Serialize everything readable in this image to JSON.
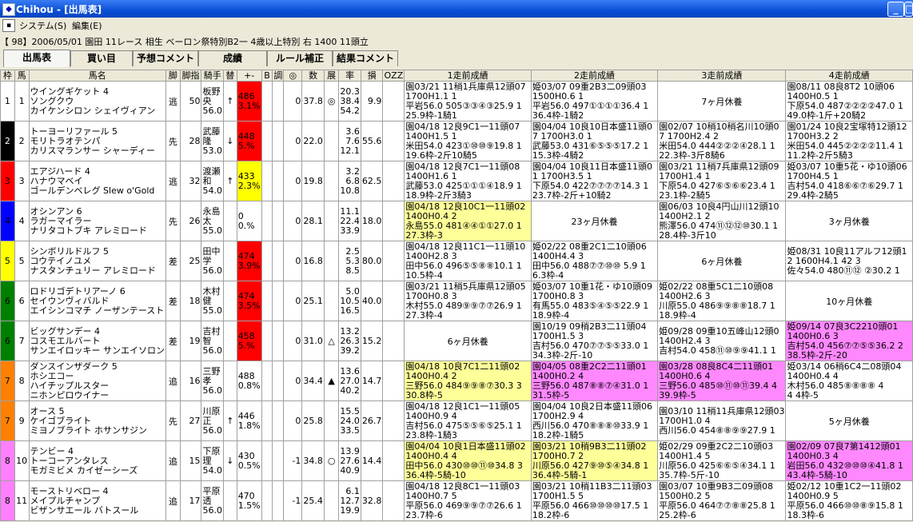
{
  "window": {
    "title": "Chihou - [出馬表]",
    "btn_min": "_",
    "btn_close": "□"
  },
  "menu": {
    "system": "システム(S)",
    "edit": "編集(E)"
  },
  "race_info": "【 98】2006/05/01 園田 11レース 相生 ベーロン祭特別B2一 4歳以上特別 右 1400 11頭立",
  "tabs": [
    "出馬表",
    "買い目",
    "予想コメント",
    "成績",
    "ルール補正",
    "結果コメント"
  ],
  "headers": [
    "枠",
    "馬",
    "馬名",
    "脚",
    "脚指",
    "騎手",
    "替",
    "+-",
    "B",
    "調",
    "◎",
    "数",
    "展",
    "率",
    "損",
    "OZZ",
    "1走前成績",
    "2走前成績",
    "3走前成績",
    "4走前成績"
  ],
  "colors": {
    "waku1": "#ffffff",
    "waku2": "#000000",
    "waku3": "#ff0000",
    "waku4": "#0000ff",
    "waku5": "#ffff00",
    "waku6": "#008000",
    "waku7": "#ff8000",
    "waku8": "#ff80ff",
    "highlight_yellow": "#ffff99",
    "highlight_pink": "#ff88ff"
  },
  "rows": [
    {
      "waku": "1",
      "ban": "1",
      "wcolor": "#ffffff",
      "wtext": "#000",
      "name": [
        "ウイングギケット 4",
        "ソングクウ",
        "カイケンシロン シェイヴィアン"
      ],
      "kyaku": "逃",
      "shi": "50",
      "jockey": [
        "板野",
        "央",
        "56.0"
      ],
      "ka": "↑",
      "diff": [
        "486",
        "3.1%"
      ],
      "diffbg": "red",
      "b": "",
      "cho": "0",
      "shirushi": "37.8",
      "kazu": "◎",
      "ten": "",
      "odds": [
        "20.3",
        "38.4",
        "54.2"
      ],
      "son": "9.9",
      "r1": {
        "lines": [
          "園03/21 11稍1兵庫県12頭07",
          "1700H1.1 1",
          "平岩56.0 505③③④③25.9 1",
          "25.9枠-1騎1"
        ],
        "bg": ""
      },
      "r2": {
        "lines": [
          "姫03/07 09重2B3二09頭03",
          "1500H0.6 1",
          "平岩56.0 497①①①①36.4 1",
          "36.4枠-1騎2"
        ],
        "bg": ""
      },
      "r3": {
        "rest": "7ヶ月休養",
        "bg": ""
      },
      "r4": {
        "lines": [
          "園08/11 08良8T2 10頭06",
          "1400H0.5 1",
          "下原54.0 487②②②②47.0 1",
          "49.0枠-1斤+20騎2"
        ],
        "bg": ""
      }
    },
    {
      "waku": "2",
      "ban": "2",
      "wcolor": "#000000",
      "wtext": "#fff",
      "name": [
        "トーヨーリファール 5",
        "モリトラオテンパ",
        "カリスマランサー シャーディー"
      ],
      "kyaku": "先",
      "shi": "28",
      "jockey": [
        "武藤",
        "隆",
        "53.0"
      ],
      "ka": "↓",
      "diff": [
        "448",
        "5.%"
      ],
      "diffbg": "red",
      "b": "",
      "cho": "0",
      "shirushi": "22.0",
      "kazu": "",
      "ten": "",
      "odds": [
        "3.6",
        "7.6",
        "12.1"
      ],
      "son": "55.6",
      "r1": {
        "lines": [
          "園04/18 12良9C1一11頭07",
          "1400H1.5 1",
          "米田54.0 423①⑩⑩⑨19.8 1",
          "19.6枠-2斤10騎5"
        ],
        "bg": ""
      },
      "r2": {
        "lines": [
          "園04/04 10良10日本盛11頭0",
          "7 1700H3.0 1",
          "武藤53.0 431⑥⑤⑤⑤17.2 1",
          "15.3枠-4騎2"
        ],
        "bg": ""
      },
      "r3": {
        "lines": [
          "園02/07 10稍10稍名川10頭0",
          "7 1700H2.4 2",
          "米田54.0 444②②②④28.1 1",
          "22.3枠-3斤8騎6"
        ],
        "bg": ""
      },
      "r4": {
        "lines": [
          "園01/24 10良2宝塚特12頭12",
          "1700H3.2 2",
          "米田54.0 445②②②②11.4 1",
          "11.2枠-2斤5騎3"
        ],
        "bg": ""
      }
    },
    {
      "waku": "3",
      "ban": "3",
      "wcolor": "#ff0000",
      "wtext": "#000",
      "name": [
        "エアジハード 4",
        "ハナウマベイ",
        "ゴールデンベレグ Slew o'Gold"
      ],
      "kyaku": "逃",
      "shi": "32",
      "jockey": [
        "渡瀬",
        "和",
        "54.0"
      ],
      "ka": "↑",
      "diff": [
        "433",
        "2.3%"
      ],
      "diffbg": "ybg",
      "b": "",
      "cho": "0",
      "shirushi": "19.8",
      "kazu": "",
      "ten": "",
      "odds": [
        "3.2",
        "6.8",
        "10.8"
      ],
      "son": "62.5",
      "r1": {
        "lines": [
          "園04/18 12良7C1一11頭08",
          "1400H1.6 1",
          "武藤53.0 425①①①④18.9 1",
          "18.9枠-2斤3騎3"
        ],
        "bg": ""
      },
      "r2": {
        "lines": [
          "園04/04 10良11日本盛11頭0",
          "1 1700H3.5 1",
          "下原54.0 422⑦⑦⑦⑦14.3 1",
          "23.7枠-2斤+10騎2"
        ],
        "bg": ""
      },
      "r3": {
        "lines": [
          "園03/21 11稍7兵庫県12頭09",
          "1700H1.4 1",
          "下原54.0 427⑥⑤⑥⑥23.4 1",
          "23.1枠-2騎5"
        ],
        "bg": ""
      },
      "r4": {
        "lines": [
          "姫03/07 10重5花・ゆ10頭06",
          "1700H4.5 1",
          "吉村54.0 418⑥⑥⑦⑥29.7 1",
          "29.4枠-2騎5"
        ],
        "bg": ""
      }
    },
    {
      "waku": "4",
      "ban": "4",
      "wcolor": "#0000ff",
      "wtext": "#000",
      "name": [
        "オシンアン 6",
        "ラガーマイラー",
        "ナリタコトブキ アレミロード"
      ],
      "kyaku": "先",
      "shi": "26",
      "jockey": [
        "永島",
        "太",
        "55.0"
      ],
      "ka": "",
      "diff": [
        "0",
        "0.%"
      ],
      "diffbg": "",
      "b": "",
      "cho": "0",
      "shirushi": "28.1",
      "kazu": "",
      "ten": "",
      "odds": [
        "11.1",
        "22.4",
        "33.9"
      ],
      "son": "18.0",
      "r1": {
        "lines": [
          "園04/18 12良10C1一11頭02",
          "1400H0.4 2",
          "永島55.0 481④④①①27.0 1",
          "27.3枠-3"
        ],
        "bg": "yellow"
      },
      "r2": {
        "rest": "23ヶ月休養",
        "bg": ""
      },
      "r3": {
        "lines": [
          "園06/03 10良4円山川12頭10",
          "1400H2.1 2",
          "熊澤56.0 474⑪⑫⑫⑩30.1 1",
          "28.4枠-3斤10"
        ],
        "bg": ""
      },
      "r4": {
        "rest": "3ヶ月休養",
        "bg": ""
      }
    },
    {
      "waku": "5",
      "ban": "5",
      "wcolor": "#ffff00",
      "wtext": "#000",
      "name": [
        "シンボリルドルフ 5",
        "コウテイノユメ",
        "ナスタンチュリー アレミロード"
      ],
      "kyaku": "差",
      "shi": "25",
      "jockey": [
        "田中",
        "学",
        "56.0"
      ],
      "ka": "",
      "diff": [
        "474",
        "3.9%"
      ],
      "diffbg": "red",
      "b": "",
      "cho": "0",
      "shirushi": "16.8",
      "kazu": "",
      "ten": "",
      "odds": [
        "2.5",
        "5.3",
        "8.5"
      ],
      "son": "80.0",
      "r1": {
        "lines": [
          "園04/18 12良11C1一11頭10",
          "1400H2.8 3",
          "田中56.0 496⑤⑤⑧⑧10.1 1",
          "10.5枠-4"
        ],
        "bg": ""
      },
      "r2": {
        "lines": [
          "姫02/22 08重2C1二10頭06",
          "1400H4.4 3",
          "田中56.0 488⑦⑦⑩⑩ 5.9 1",
          "6.3枠-4"
        ],
        "bg": ""
      },
      "r3": {
        "rest": "6ヶ月休養",
        "bg": ""
      },
      "r4": {
        "lines": [
          "姫08/31 10良11アルフ12頭1",
          "2 1600H4.1 42 3",
          "佐々54.0 480⑪⑫ ②30.2 1"
        ],
        "bg": ""
      }
    },
    {
      "waku": "6",
      "ban": "6",
      "wcolor": "#008000",
      "wtext": "#000",
      "name": [
        "ロドリゴデトリアーノ 6",
        "セイウンヴィバルド",
        "エイシンコマチ ノーザンテースト"
      ],
      "kyaku": "差",
      "shi": "18",
      "jockey": [
        "木村",
        "健",
        "55.0"
      ],
      "ka": "",
      "diff": [
        "474",
        "3.5%"
      ],
      "diffbg": "red",
      "b": "",
      "cho": "0",
      "shirushi": "25.1",
      "kazu": "",
      "ten": "",
      "odds": [
        "5.0",
        "10.5",
        "16.5"
      ],
      "son": "40.0",
      "r1": {
        "lines": [
          "園03/21 11稍5兵庫県12頭05",
          "1700H0.8 3",
          "木村55.0 489⑨⑨⑦⑦26.9 1",
          "27.3枠-4"
        ],
        "bg": ""
      },
      "r2": {
        "lines": [
          "姫03/07 10重1花・ゆ10頭09",
          "1700H0.8 3",
          "有馬55.0 483⑤④⑤⑤22.9 1",
          "18.9枠-4"
        ],
        "bg": ""
      },
      "r3": {
        "lines": [
          "姫02/22 08重5C1二10頭08",
          "1400H2.6 3",
          "川原55.0 486⑨⑨⑧⑧18.7 1",
          "18.9枠-4"
        ],
        "bg": ""
      },
      "r4": {
        "rest": "10ヶ月休養",
        "bg": ""
      }
    },
    {
      "waku": "6",
      "ban": "7",
      "wcolor": "#008000",
      "wtext": "#000",
      "name": [
        "ビッグサンデー 4",
        "コスモエルバート",
        "サンエイロッキー サンエイソロン"
      ],
      "kyaku": "差",
      "shi": "19",
      "jockey": [
        "吉村",
        "智",
        "56.0"
      ],
      "ka": "",
      "diff": [
        "458",
        "5.%"
      ],
      "diffbg": "red",
      "b": "",
      "cho": "0",
      "shirushi": "31.0",
      "kazu": "△",
      "ten": "",
      "odds": [
        "13.2",
        "26.3",
        "39.2"
      ],
      "son": "15.2",
      "r1": {
        "rest": "6ヶ月休養",
        "bg": ""
      },
      "r2": {
        "lines": [
          "園10/19 09稍2B3二11頭04",
          "1700H1.5 3",
          "吉村56.0 470⑦⑦⑤⑤33.0 1",
          "34.3枠-2斤-10"
        ],
        "bg": ""
      },
      "r3": {
        "lines": [
          "姫09/28 09重10五峰山12頭0",
          "1400H2.4 3",
          "吉村54.0 458⑪⑩⑨⑨41.1 1"
        ],
        "bg": ""
      },
      "r4": {
        "lines": [
          "姫09/14 07良3C2210頭01",
          "1400H0.6 3",
          "吉村54.0 456⑦⑦⑤⑤36.2 2",
          "38.5枠-2斤-20"
        ],
        "bg": "pink"
      }
    },
    {
      "waku": "7",
      "ban": "8",
      "wcolor": "#ff8000",
      "wtext": "#000",
      "name": [
        "ダンスインザダーク 5",
        "ホシエコー",
        "ハイチップルスター",
        "ニホンピロウイナー"
      ],
      "kyaku": "追",
      "shi": "16",
      "jockey": [
        "三野",
        "孝",
        "56.0"
      ],
      "ka": "",
      "diff": [
        "488",
        "0.8%"
      ],
      "diffbg": "",
      "b": "",
      "cho": "0",
      "shirushi": "34.4",
      "kazu": "▲",
      "ten": "",
      "odds": [
        "13.6",
        "27.0",
        "40.2"
      ],
      "son": "14.7",
      "r1": {
        "lines": [
          "園04/18 10良7C1二11頭02",
          "1400H0.4 2",
          "三野56.0 484⑨⑨⑧⑦30.3 3",
          "30.8枠-5"
        ],
        "bg": "yellow"
      },
      "r2": {
        "lines": [
          "園04/05 08重2C2二11頭01",
          "1400H0.2 4",
          "三野56.0 487⑧⑧⑦④31.0 1",
          "31.5枠-5"
        ],
        "bg": "pink"
      },
      "r3": {
        "lines": [
          "園03/28 08良8C4二11頭01",
          "1400H0.6 4",
          "三野56.0 485⑩⑪⑩⑪39.4 4",
          "39.9枠-5"
        ],
        "bg": "pink"
      },
      "r4": {
        "lines": [
          "姫03/14 06稍6C4二08頭04",
          "1400H0.4 4",
          "木村56.0 485⑧⑧⑧⑧ 4",
          "4 4枠-5"
        ],
        "bg": ""
      }
    },
    {
      "waku": "7",
      "ban": "9",
      "wcolor": "#ff8000",
      "wtext": "#000",
      "name": [
        "オース 5",
        "ケイゴブライト",
        "ミヨノブライト ホサンサジン"
      ],
      "kyaku": "先",
      "shi": "27",
      "jockey": [
        "川原",
        "正",
        "56.0"
      ],
      "ka": "↑",
      "diff": [
        "446",
        "1.8%"
      ],
      "diffbg": "",
      "b": "",
      "cho": "0",
      "shirushi": "25.8",
      "kazu": "",
      "ten": "",
      "odds": [
        "15.5",
        "24.0",
        "33.5"
      ],
      "son": "26.7",
      "r1": {
        "lines": [
          "園04/18 12良1C1一11頭05",
          "1400H0.9 4",
          "吉村56.0 475⑤⑤⑥⑤25.1 1",
          "23.8枠-1騎3"
        ],
        "bg": ""
      },
      "r2": {
        "lines": [
          "園04/04 10良2日本盛11頭06",
          "1700H2.9 4",
          "西川56.0 470⑧⑧⑧⑩33.9 1",
          "18.2枠-1騎5"
        ],
        "bg": ""
      },
      "r3": {
        "lines": [
          "園03/10 11稍11兵庫県12頭03",
          "1700H1.0 4",
          "西川56.0 454⑧⑧⑨⑨27.9 1"
        ],
        "bg": ""
      },
      "r4": {
        "rest": "5ヶ月休養",
        "bg": ""
      }
    },
    {
      "waku": "8",
      "ban": "10",
      "wcolor": "#ff80ff",
      "wtext": "#000",
      "name": [
        "テンビー 4",
        "トーコーアンタレス",
        "モガミビメ カイゼーシーズ"
      ],
      "kyaku": "追",
      "shi": "15",
      "jockey": [
        "下原",
        "理",
        "54.0"
      ],
      "ka": "↓",
      "diff": [
        "430",
        "0.5%"
      ],
      "diffbg": "",
      "b": "",
      "cho": "-1",
      "shirushi": "34.8",
      "kazu": "○",
      "ten": "",
      "odds": [
        "13.9",
        "27.6",
        "40.9"
      ],
      "son": "14.4",
      "r1": {
        "lines": [
          "園04/04 10良1日本盛11頭02",
          "1400H0.4 4",
          "田中56.0 430⑩⑩⑪⑩34.8 3",
          "36.4枠-5騎-10"
        ],
        "bg": "yellow"
      },
      "r2": {
        "lines": [
          "園03/21 10稍9B3二11頭02",
          "1700H0.7 2",
          "川原56.0 427⑨⑩⑤④34.8 1",
          "36.4枠-5騎-1"
        ],
        "bg": "yellow"
      },
      "r3": {
        "lines": [
          "姫02/29 09重2C2二10頭03",
          "1400H1.4 5",
          "川原56.0 425⑥⑥⑤④34.1 1",
          "35.7枠-5斤-10"
        ],
        "bg": ""
      },
      "r4": {
        "lines": [
          "園02/09 07良7第1412頭01",
          "1400H0.3 4",
          "岩田56.0 432⑩⑩⑩④41.8 1",
          "43.4枠-5騎-10"
        ],
        "bg": "pink"
      }
    },
    {
      "waku": "8",
      "ban": "11",
      "wcolor": "#ff80ff",
      "wtext": "#000",
      "name": [
        "モーストリベロー 4",
        "メイプルチャンプ",
        "ビザンサエール バトスール"
      ],
      "kyaku": "追",
      "shi": "17",
      "jockey": [
        "平原",
        "透",
        "56.0"
      ],
      "ka": "",
      "diff": [
        "470",
        "1.5%"
      ],
      "diffbg": "",
      "b": "",
      "cho": "-1",
      "shirushi": "25.4",
      "kazu": "",
      "ten": "",
      "odds": [
        "6.1",
        "12.7",
        "19.9"
      ],
      "son": "32.8",
      "r1": {
        "lines": [
          "園04/18 12良8C1一11頭03",
          "1400H0.7 5",
          "平原56.0 469⑨⑨⑦⑦26.6 1",
          "23.7枠-6"
        ],
        "bg": ""
      },
      "r2": {
        "lines": [
          "園03/21 10稍11B3二11頭03",
          "1700H1.5 5",
          "平原56.0 466⑩⑩⑩⑩17.5 1",
          "18.2枠-6"
        ],
        "bg": ""
      },
      "r3": {
        "lines": [
          "園03/07 10重9B3二09頭08",
          "1500H0.2 5",
          "平原56.0 464⑦⑦⑧⑧25.8 1",
          "25.2枠-6"
        ],
        "bg": ""
      },
      "r4": {
        "lines": [
          "姫02/12 10重1C2一11頭02",
          "1400H0.9 5",
          "平原56.0 466⑩⑩⑧⑨15.8 1",
          "18.3枠-6"
        ],
        "bg": ""
      }
    }
  ]
}
